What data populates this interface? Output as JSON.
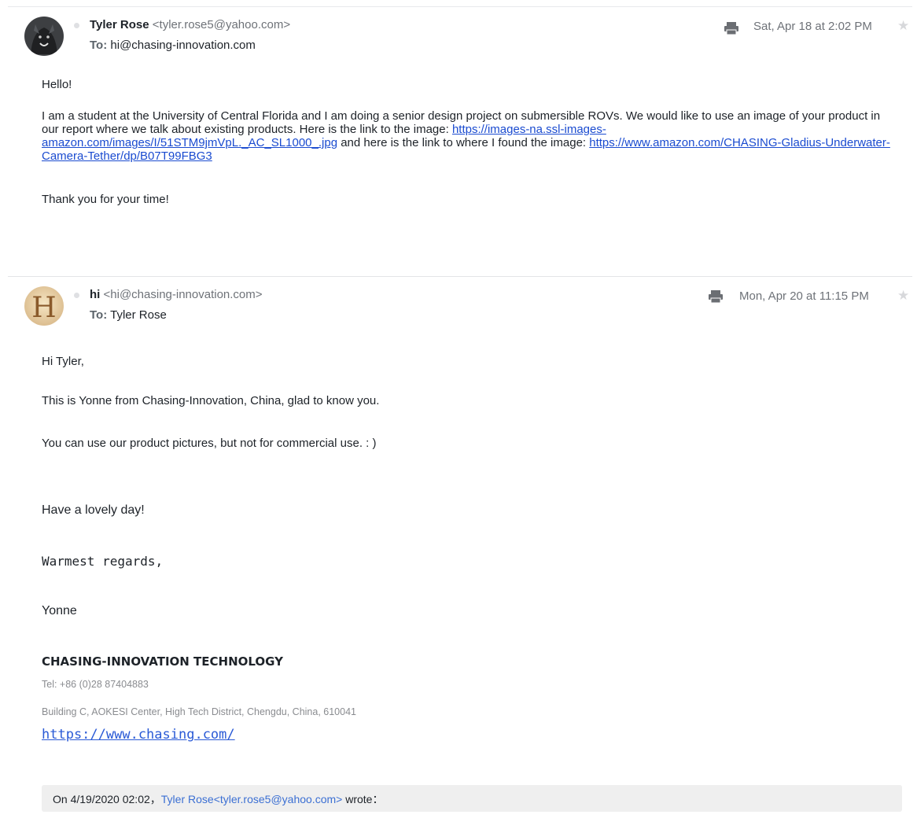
{
  "messages": [
    {
      "sender_name": "Tyler Rose",
      "sender_email": "<tyler.rose5@yahoo.com>",
      "to_label": "To:",
      "to_value": "hi@chasing-innovation.com",
      "date": "Sat, Apr 18 at 2:02 PM",
      "avatar_icon": "wolf-avatar-icon",
      "body": {
        "greeting": "Hello!",
        "p1_text1": "I am a student at the University of Central Florida and I am doing a senior design project on submersible ROVs. We would like to use an image of your product in our report where we talk about existing products. Here is the link to the image: ",
        "p1_link1": "https://images-na.ssl-images-amazon.com/images/I/51STM9jmVpL._AC_SL1000_.jpg",
        "p1_text2": " and here is the link to where I found the image: ",
        "p1_link2": "https://www.amazon.com/CHASING-Gladius-Underwater-Camera-Tether/dp/B07T99FBG3",
        "closing": "Thank you for your time!"
      }
    },
    {
      "sender_name": "hi",
      "sender_email": "<hi@chasing-innovation.com>",
      "to_label": "To:",
      "to_value": "Tyler Rose",
      "date": "Mon, Apr 20 at 11:15 PM",
      "avatar_icon": "letter-h-avatar-icon",
      "avatar_letter": "H",
      "body": {
        "greeting": "Hi Tyler,",
        "line1": "This is Yonne from Chasing-Innovation, China, glad to know you.",
        "line2": "You can use our product pictures, but not for commercial use. : )",
        "line3": "Have a lovely day!",
        "regards": "Warmest regards,",
        "name": "Yonne",
        "company": "CHASING-INNOVATION TECHNOLOGY",
        "tel": "Tel: +86 (0)28 87404883",
        "address": "Building C, AOKESI Center, High Tech District, Chengdu, China, 610041",
        "website": "https://www.chasing.com/"
      },
      "quote": {
        "prefix": "On 4/19/2020 02:02，",
        "author": "Tyler Rose<tyler.rose5@yahoo.com>",
        "suffix": " wrote："
      }
    }
  ],
  "colors": {
    "link": "#1a4bd0",
    "quote_link": "#3b6fd3",
    "quote_bg": "#efefef"
  }
}
